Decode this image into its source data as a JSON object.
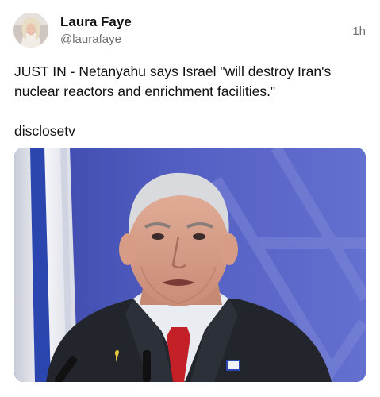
{
  "post": {
    "author": {
      "name": "Laura Faye",
      "handle": "@laurafaye",
      "avatar_icon": "user-avatar-photo"
    },
    "timestamp": "1h",
    "text": "JUST IN - Netanyahu says Israel \"will destroy Iran's nuclear reactors and enrichment facilities.\"",
    "source": "disclosetv",
    "media": {
      "type": "photo",
      "dominant_colors": {
        "background_blue": "#4a56b8",
        "flag_white": "#f2f3f6",
        "flag_blue": "#2c46b0",
        "suit": "#22252b",
        "tie": "#c42027"
      }
    }
  }
}
